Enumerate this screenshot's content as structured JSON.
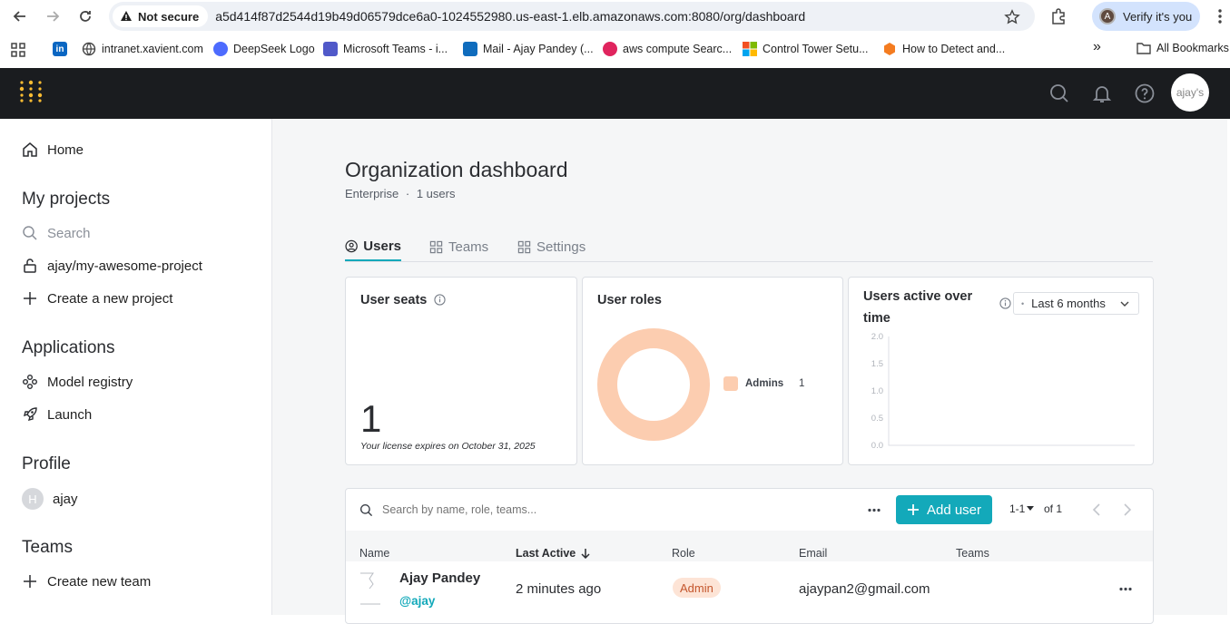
{
  "browser": {
    "not_secure_label": "Not secure",
    "url": "a5d414f87d2544d19b49d06579dce6a0-1024552980.us-east-1.elb.amazonaws.com:8080/org/dashboard",
    "verify_label": "Verify it's you",
    "verify_avatar_letter": "A",
    "bookmarks": [
      {
        "label": "intranet.xavient.com",
        "icon": "globe-icon"
      },
      {
        "label": "DeepSeek Logo",
        "icon": "deepseek-icon"
      },
      {
        "label": "Microsoft Teams - i...",
        "icon": "teams-icon"
      },
      {
        "label": "Mail - Ajay Pandey (...",
        "icon": "outlook-icon"
      },
      {
        "label": "aws compute Searc...",
        "icon": "search-app-icon"
      },
      {
        "label": "Control Tower Setu...",
        "icon": "microsoft-icon"
      },
      {
        "label": "How to Detect and...",
        "icon": "hex-icon"
      }
    ],
    "all_bookmarks_label": "All Bookmarks",
    "more_label": "»"
  },
  "header": {
    "avatar_alt": "ajay's"
  },
  "sidebar": {
    "home_label": "Home",
    "projects_heading": "My projects",
    "search_placeholder": "Search",
    "project_label": "ajay/my-awesome-project",
    "create_project_label": "Create a new project",
    "applications_heading": "Applications",
    "model_registry_label": "Model registry",
    "launch_label": "Launch",
    "profile_heading": "Profile",
    "profile_initial": "H",
    "profile_name": "ajay",
    "teams_heading": "Teams",
    "create_team_label": "Create new team"
  },
  "main": {
    "title": "Organization dashboard",
    "subtitle_plan": "Enterprise",
    "subtitle_sep": "·",
    "subtitle_users": "1 users",
    "tabs": [
      {
        "label": "Users",
        "active": true
      },
      {
        "label": "Teams",
        "active": false
      },
      {
        "label": "Settings",
        "active": false
      }
    ]
  },
  "seats": {
    "title": "User seats",
    "count": "1",
    "license_note": "Your license expires on October 31, 2025"
  },
  "roles": {
    "title": "User roles",
    "legend_label": "Admins",
    "legend_count": "1",
    "color": "#fccdb0"
  },
  "activity": {
    "title_line1": "Users active over",
    "title_line2": "time",
    "range_label": "Last 6 months",
    "range_dot": "•"
  },
  "chart_data": {
    "type": "line",
    "title": "Users active over time",
    "y_ticks": [
      "2.0",
      "1.5",
      "1.0",
      "0.5",
      "0.0"
    ],
    "ylim": [
      0,
      2
    ],
    "series": []
  },
  "users_table": {
    "search_placeholder": "Search by name, role, teams...",
    "add_user_label": "Add user",
    "pagination_range": "1-1",
    "pagination_of": "of 1",
    "columns": [
      "Name",
      "Last Active",
      "Role",
      "Email",
      "Teams"
    ],
    "rows": [
      {
        "name": "Ajay Pandey",
        "handle": "@ajay",
        "last_active": "2 minutes ago",
        "role": "Admin",
        "email": "ajaypan2@gmail.com",
        "teams": ""
      }
    ]
  },
  "colors": {
    "accent": "#13a9ba",
    "header_bg": "#1a1c1f",
    "logo": "#fcbc32"
  }
}
